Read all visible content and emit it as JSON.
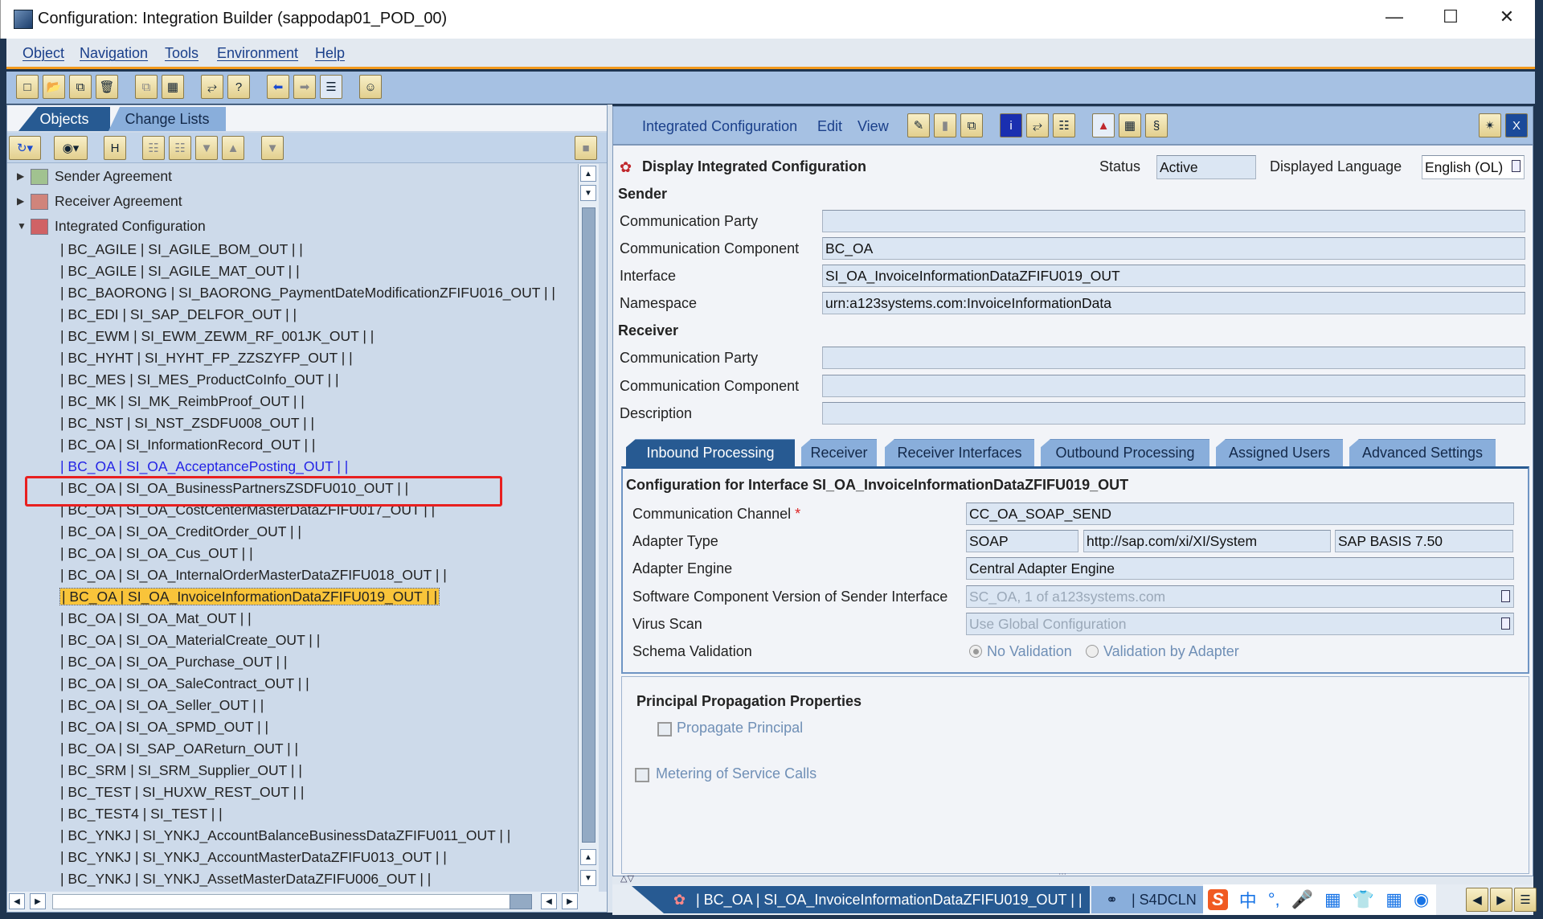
{
  "window": {
    "title": "Configuration: Integration Builder (sappodap01_POD_00)",
    "controls": [
      "minimize-icon",
      "maximize-icon",
      "close-icon"
    ]
  },
  "menu": [
    "Object",
    "Navigation",
    "Tools",
    "Environment",
    "Help"
  ],
  "left": {
    "tabs": [
      "Objects",
      "Change Lists"
    ],
    "active_tab": "Objects",
    "tree": {
      "groups": [
        {
          "label": "Sender Agreement",
          "expanded": false,
          "icon": "sender-agreement-icon"
        },
        {
          "label": "Receiver Agreement",
          "expanded": false,
          "icon": "receiver-agreement-icon"
        },
        {
          "label": "Integrated Configuration",
          "expanded": true,
          "icon": "integrated-configuration-icon"
        }
      ],
      "items": [
        "| BC_AGILE | SI_AGILE_BOM_OUT | |",
        "| BC_AGILE | SI_AGILE_MAT_OUT | |",
        "| BC_BAORONG | SI_BAORONG_PaymentDateModificationZFIFU016_OUT | |",
        "| BC_EDI | SI_SAP_DELFOR_OUT | |",
        "| BC_EWM | SI_EWM_ZEWM_RF_001JK_OUT | |",
        "| BC_HYHT | SI_HYHT_FP_ZZSZYFP_OUT | |",
        "| BC_MES | SI_MES_ProductCoInfo_OUT | |",
        "| BC_MK | SI_MK_ReimbProof_OUT | |",
        "| BC_NST | SI_NST_ZSDFU008_OUT | |",
        "| BC_OA | SI_InformationRecord_OUT | |",
        "| BC_OA | SI_OA_AcceptancePosting_OUT | |",
        "| BC_OA | SI_OA_BusinessPartnersZSDFU010_OUT | |",
        "| BC_OA | SI_OA_CostCenterMasterDataZFIFU017_OUT | |",
        "| BC_OA | SI_OA_CreditOrder_OUT | |",
        "| BC_OA | SI_OA_Cus_OUT | |",
        "| BC_OA | SI_OA_InternalOrderMasterDataZFIFU018_OUT | |",
        "| BC_OA | SI_OA_InvoiceInformationDataZFIFU019_OUT | |",
        "| BC_OA | SI_OA_Mat_OUT | |",
        "| BC_OA | SI_OA_MaterialCreate_OUT | |",
        "| BC_OA | SI_OA_Purchase_OUT | |",
        "| BC_OA | SI_OA_SaleContract_OUT | |",
        "| BC_OA | SI_OA_Seller_OUT | |",
        "| BC_OA | SI_OA_SPMD_OUT | |",
        "| BC_OA | SI_SAP_OAReturn_OUT | |",
        "| BC_SRM | SI_SRM_Supplier_OUT | |",
        "| BC_TEST | SI_HUXW_REST_OUT | |",
        "| BC_TEST4 | SI_TEST | |",
        "| BC_YNKJ | SI_YNKJ_AccountBalanceBusinessDataZFIFU011_OUT | |",
        "| BC_YNKJ | SI_YNKJ_AccountMasterDataZFIFU013_OUT | |",
        "| BC_YNKJ | SI_YNKJ_AssetMasterDataZFIFU006_OUT | |"
      ],
      "selected_index": 16,
      "link_index": 10
    }
  },
  "right": {
    "menu": [
      "Integrated Configuration",
      "Edit",
      "View"
    ],
    "heading": "Display Integrated Configuration",
    "status_label": "Status",
    "status_value": "Active",
    "language_label": "Displayed Language",
    "language_value": "English (OL)",
    "sender": {
      "title": "Sender",
      "communication_party_label": "Communication Party",
      "communication_party": "",
      "communication_component_label": "Communication Component",
      "communication_component": "BC_OA",
      "interface_label": "Interface",
      "interface": "SI_OA_InvoiceInformationDataZFIFU019_OUT",
      "namespace_label": "Namespace",
      "namespace": "urn:a123systems.com:InvoiceInformationData"
    },
    "receiver": {
      "title": "Receiver",
      "communication_party_label": "Communication Party",
      "communication_party": "",
      "communication_component_label": "Communication Component",
      "communication_component": "",
      "description_label": "Description",
      "description": ""
    },
    "tabs": [
      "Inbound Processing",
      "Receiver",
      "Receiver Interfaces",
      "Outbound Processing",
      "Assigned Users",
      "Advanced Settings"
    ],
    "active_tab": "Inbound Processing",
    "inbound": {
      "title": "Configuration for Interface SI_OA_InvoiceInformationDataZFIFU019_OUT",
      "channel_label": "Communication Channel",
      "required_mark": "*",
      "channel": "CC_OA_SOAP_SEND",
      "adapter_type_label": "Adapter Type",
      "adapter_type": "SOAP",
      "adapter_namespace": "http://sap.com/xi/XI/System",
      "adapter_swcv": "SAP BASIS 7.50",
      "adapter_engine_label": "Adapter Engine",
      "adapter_engine": "Central Adapter Engine",
      "swcv_label": "Software Component Version of Sender Interface",
      "swcv": "SC_OA, 1 of a123systems.com",
      "virus_scan_label": "Virus Scan",
      "virus_scan": "Use Global Configuration",
      "schema_label": "Schema Validation",
      "schema_options": [
        "No Validation",
        "Validation by Adapter"
      ],
      "schema_selected": "No Validation"
    },
    "principal": {
      "title": "Principal Propagation Properties",
      "propagate_label": "Propagate Principal",
      "propagate_checked": false,
      "metering_label": "Metering of Service Calls",
      "metering_checked": false
    }
  },
  "statusbar": {
    "object_tab": "| BC_OA | SI_OA_InvoiceInformationDataZFIFU019_OUT | |",
    "system_tab": "| S4DCLN",
    "ime_chars": [
      "中",
      "°,"
    ]
  },
  "colors": {
    "accent": "#275a92",
    "toolbar": "#a6c1e3",
    "tree_bg": "#cddaea",
    "selection": "#f9c43a",
    "highlight_box": "#e82020",
    "menu_underline": "#f39a1e"
  }
}
